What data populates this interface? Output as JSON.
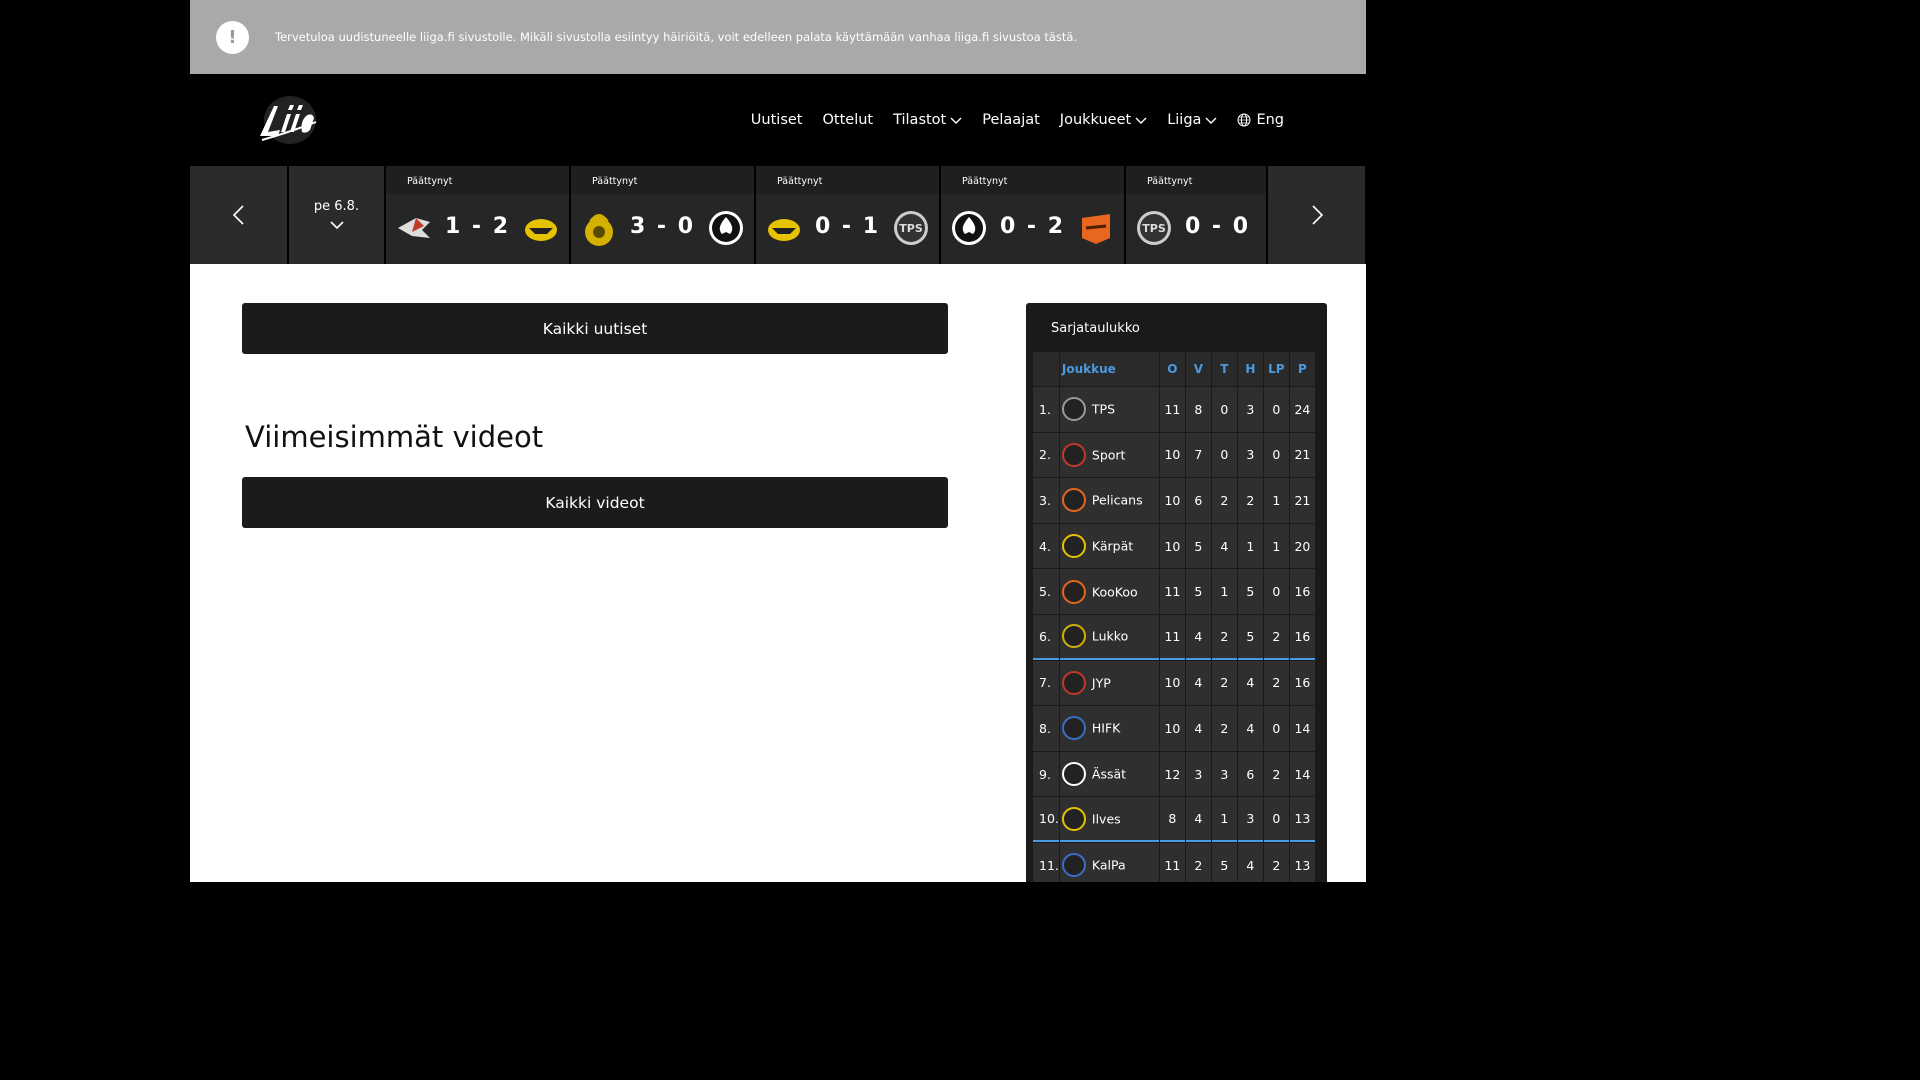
{
  "banner": {
    "icon": "exclamation-icon",
    "icon_glyph": "!",
    "text": "Tervetuloa uudistuneelle liiga.fi sivustolle. Mikäli sivustolla esiintyy häiriöitä, voit edelleen palata käyttämään vanhaa liiga.fi sivustoa tästä."
  },
  "header": {
    "logo": "Liiga",
    "nav": {
      "uutiset": "Uutiset",
      "ottelut": "Ottelut",
      "tilastot": "Tilastot",
      "pelaajat": "Pelaajat",
      "joukkueet": "Joukkueet",
      "liiga": "Liiga",
      "lang": "Eng"
    }
  },
  "scorebar": {
    "date": "pe 6.8.",
    "games": [
      {
        "status": "Päättynyt",
        "home": "Sport",
        "away": "Kärpät",
        "score": "1 - 2"
      },
      {
        "status": "Päättynyt",
        "home": "Lukko",
        "away": "Ässät",
        "score": "3 - 0"
      },
      {
        "status": "Päättynyt",
        "home": "Kärpät",
        "away": "TPS",
        "score": "0 - 1"
      },
      {
        "status": "Päättynyt",
        "home": "Ässät",
        "away": "KooKoo",
        "score": "0 - 2"
      },
      {
        "status": "Päättynyt",
        "home": "TPS",
        "away": "",
        "score": "0 - 0"
      }
    ]
  },
  "main": {
    "all_news": "Kaikki uutiset",
    "videos_title": "Viimeisimmät videot",
    "all_videos": "Kaikki videot"
  },
  "standings": {
    "title": "Sarjataulukko",
    "headers": {
      "team": "Joukkue",
      "o": "O",
      "v": "V",
      "t": "T",
      "h": "H",
      "lp": "LP",
      "p": "P"
    },
    "rows": [
      {
        "rank": "1.",
        "team": "TPS",
        "o": "11",
        "v": "8",
        "t": "0",
        "h": "3",
        "lp": "0",
        "p": "24"
      },
      {
        "rank": "2.",
        "team": "Sport",
        "o": "10",
        "v": "7",
        "t": "0",
        "h": "3",
        "lp": "0",
        "p": "21"
      },
      {
        "rank": "3.",
        "team": "Pelicans",
        "o": "10",
        "v": "6",
        "t": "2",
        "h": "2",
        "lp": "1",
        "p": "21"
      },
      {
        "rank": "4.",
        "team": "Kärpät",
        "o": "10",
        "v": "5",
        "t": "4",
        "h": "1",
        "lp": "1",
        "p": "20"
      },
      {
        "rank": "5.",
        "team": "KooKoo",
        "o": "11",
        "v": "5",
        "t": "1",
        "h": "5",
        "lp": "0",
        "p": "16"
      },
      {
        "rank": "6.",
        "team": "Lukko",
        "o": "11",
        "v": "4",
        "t": "2",
        "h": "5",
        "lp": "2",
        "p": "16"
      },
      {
        "rank": "7.",
        "team": "JYP",
        "o": "10",
        "v": "4",
        "t": "2",
        "h": "4",
        "lp": "2",
        "p": "16"
      },
      {
        "rank": "8.",
        "team": "HIFK",
        "o": "10",
        "v": "4",
        "t": "2",
        "h": "4",
        "lp": "0",
        "p": "14"
      },
      {
        "rank": "9.",
        "team": "Ässät",
        "o": "12",
        "v": "3",
        "t": "3",
        "h": "6",
        "lp": "2",
        "p": "14"
      },
      {
        "rank": "10.",
        "team": "Ilves",
        "o": "8",
        "v": "4",
        "t": "1",
        "h": "3",
        "lp": "0",
        "p": "13"
      },
      {
        "rank": "11.",
        "team": "KalPa",
        "o": "11",
        "v": "2",
        "t": "5",
        "h": "4",
        "lp": "2",
        "p": "13"
      }
    ]
  },
  "colors": {
    "accent": "#4a9ae0",
    "banner_bg": "#a9a9a9",
    "dark": "#1b1b1b"
  }
}
